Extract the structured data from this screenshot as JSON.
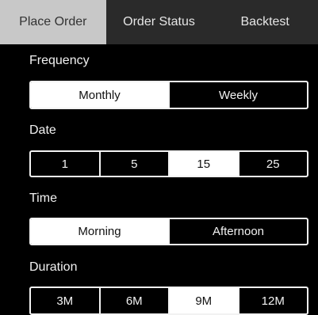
{
  "tabs": [
    "Place Order",
    "Order Status",
    "Backtest"
  ],
  "active_tab": 0,
  "frequency": {
    "label": "Frequency",
    "options": [
      "Monthly",
      "Weekly"
    ],
    "selected": 0
  },
  "date": {
    "label": "Date",
    "options": [
      "1",
      "5",
      "15",
      "25"
    ],
    "selected": 2
  },
  "time": {
    "label": "Time",
    "options": [
      "Morning",
      "Afternoon"
    ],
    "selected": 0
  },
  "duration": {
    "label": "Duration",
    "options": [
      "3M",
      "6M",
      "9M",
      "12M"
    ],
    "selected": 2
  },
  "colors": {
    "background": "#000000",
    "tabbar": "#2a2a2a",
    "active_tab": "#c8c8c8",
    "selected_option": "#ffffff"
  }
}
